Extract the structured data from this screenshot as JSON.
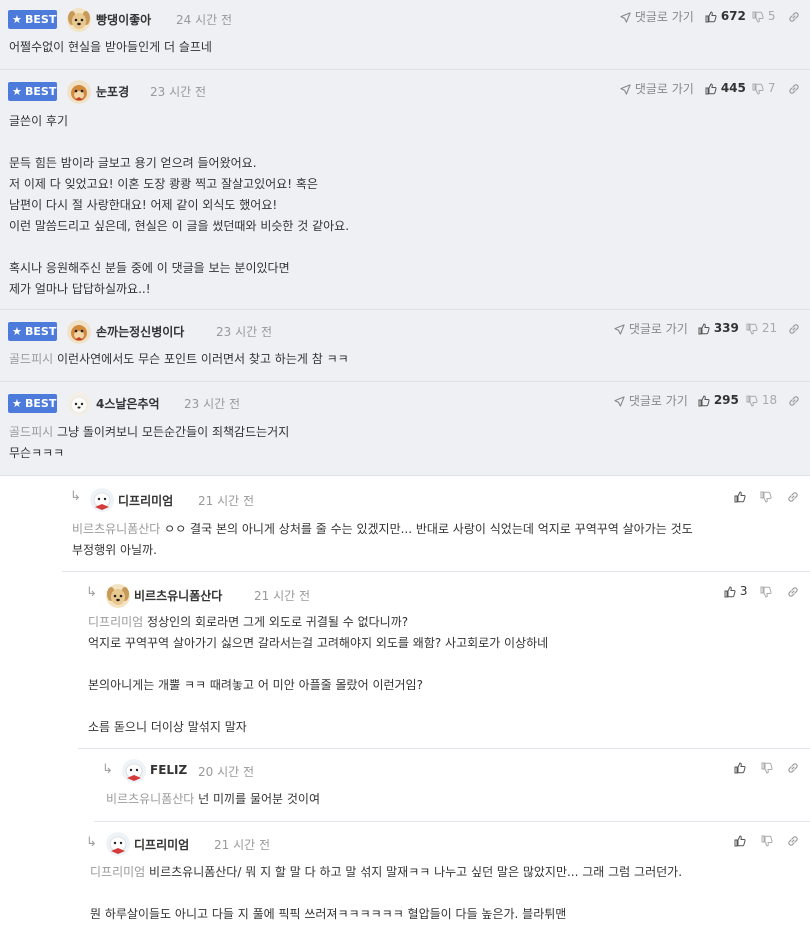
{
  "common": {
    "best_label": "BEST",
    "reply_link": "댓글로 가기"
  },
  "comments": [
    {
      "nick": "빵댕이좋아",
      "time": "24 시간 전",
      "up": "672",
      "down": "5",
      "lines": [
        "어쩔수없이 현실을 받아들인게 더 슬프네"
      ]
    },
    {
      "nick": "눈포경",
      "time": "23 시간 전",
      "up": "445",
      "down": "7",
      "lines": [
        "글쓴이 후기",
        "",
        "문득 힘든 밤이라 글보고 용기 얻으려 들어왔어요.",
        "저 이제 다 잊었고요! 이혼 도장 쾅쾅 찍고 잘살고있어요! 혹은",
        "남편이 다시 절 사랑한대요! 어제 같이 외식도 했어요!",
        "이런 말씀드리고 싶은데, 현실은 이 글을 썼던때와 비슷한 것 같아요.",
        "",
        "혹시나 응원해주신 분들 중에 이 댓글을 보는 분이있다면",
        "제가 얼마나 답답하실까요..!"
      ]
    },
    {
      "nick": "손까는정신병이다",
      "time": "23 시간 전",
      "up": "339",
      "down": "21",
      "mention": "골드피시",
      "lines": [
        "이런사연에서도 무슨 포인트 이러면서 찾고 하는게 참 ㅋㅋ"
      ]
    },
    {
      "nick": "4스날은추억",
      "time": "23 시간 전",
      "up": "295",
      "down": "18",
      "mention": "골드피시",
      "lines": [
        "그냥 돌이켜보니 모든순간들이 죄책감드는거지",
        "무슨ㅋㅋㅋ"
      ]
    }
  ],
  "replies": [
    {
      "nick": "디프리미엄",
      "time": "21 시간 전",
      "mention": "비르츠유니폼산다",
      "lines": [
        "ㅇㅇ 결국 본의 아니게 상처를 줄 수는 있겠지만... 반대로 사랑이 식었는데 억지로 꾸역꾸역 살아가는 것도",
        "부정행위 아닐까."
      ]
    },
    {
      "nick": "비르츠유니폼산다",
      "time": "21 시간 전",
      "up": "3",
      "mention": "디프리미엄",
      "lines": [
        "정상인의 회로라면 그게 외도로 귀결될 수 없다니까?",
        "억지로 꾸역꾸역 살아가기 싫으면 갈라서는걸 고려해야지 외도를 왜함? 사고회로가 이상하네",
        "",
        "본의아니게는 개뿔 ㅋㅋ 때려놓고 어 미안 아플줄 몰랐어 이런거임?",
        "",
        "소름 돋으니 더이상 말섞지 말자"
      ]
    },
    {
      "nick": "FELIZ",
      "time": "20 시간 전",
      "mention": "비르츠유니폼산다",
      "lines": [
        "넌 미끼를 물어분 것이여"
      ]
    },
    {
      "nick": "디프리미엄",
      "time": "21 시간 전",
      "mention": "디프리미엄",
      "lines": [
        "비르츠유니폼산다/ 뭐 지 할 말 다 하고 말 섞지 말재ㅋㅋ 나누고 싶던 말은 많았지만... 그래 그럼 그러던가.",
        "",
        "뭔 하루살이들도 아니고 다들 지 풀에 픽픽 쓰러져ㅋㅋㅋㅋㅋㅋ 혈압들이 다들 높은가. 블라튀맨"
      ]
    }
  ],
  "colors": {
    "best_badge": "#4d7bdb",
    "best_bg": "#eef0f4",
    "mention": "#9a9a9a"
  },
  "icons": [
    "star-icon",
    "paper-plane-icon",
    "thumbs-up-icon",
    "thumbs-down-icon",
    "link-icon",
    "reply-arrow-icon"
  ]
}
